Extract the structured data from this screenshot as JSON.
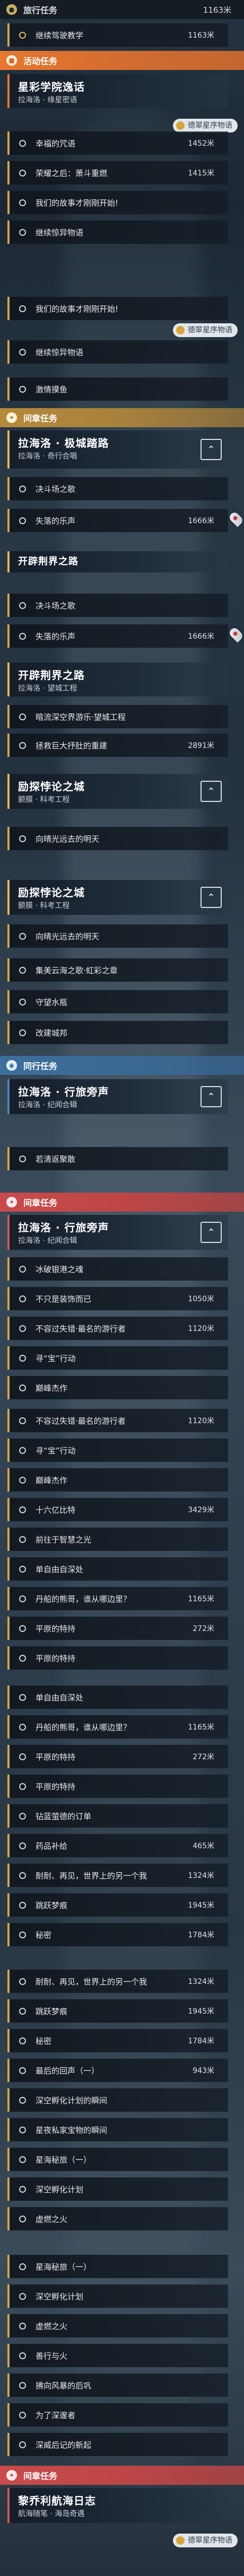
{
  "sections": {
    "journey": {
      "label": "旅行任务",
      "count": "1163米",
      "icon": "location-pin-icon"
    },
    "event": {
      "label": "活动任务",
      "icon": "calendar-icon"
    },
    "interlude1": {
      "label": "间章任务",
      "icon": "sparkle-icon"
    },
    "companion1": {
      "label": "同行任务",
      "icon": "people-icon"
    },
    "interlude2": {
      "label": "间章任务",
      "icon": "sparkle-icon"
    },
    "companion2": {
      "label": "同行任务",
      "icon": "people-icon"
    },
    "interlude3": {
      "label": "间章任务",
      "icon": "sparkle-icon"
    }
  },
  "rows": {
    "r0": {
      "label": "继续驾驶教学",
      "dist": "1163米"
    },
    "r1": {
      "label": "幸福的咒语",
      "dist": "1452米"
    },
    "r2": {
      "label": "荣耀之后：萧斗重燃",
      "dist": "1415米"
    },
    "r3": {
      "label": "我们的故事才刚刚开始!",
      "dist": ""
    },
    "r4": {
      "label": "继续惊异物语",
      "dist": ""
    },
    "r5": {
      "label": "我们的故事才刚刚开始!",
      "dist": ""
    },
    "r6": {
      "label": "继续惊异物语",
      "dist": ""
    },
    "r7": {
      "label": "激情摸鱼",
      "dist": ""
    },
    "r8": {
      "label": "决斗场之歌",
      "dist": ""
    },
    "r9": {
      "label": "失落的乐声",
      "dist": "1666米"
    },
    "r10": {
      "label": "决斗场之歌",
      "dist": ""
    },
    "r11": {
      "label": "失落的乐声",
      "dist": "1666米"
    },
    "r12": {
      "label": "暗流深空界游乐·望城工程",
      "dist": ""
    },
    "r13": {
      "label": "拯救巨大抒肚的重建",
      "dist": "2891米"
    },
    "r14": {
      "label": "向晴光远去的明天",
      "dist": ""
    },
    "r15": {
      "label": "向晴光远去的明天",
      "dist": ""
    },
    "r16": {
      "label": "集美云海之歌·虹彩之章",
      "dist": ""
    },
    "r17": {
      "label": "守望水瓶",
      "dist": ""
    },
    "r18": {
      "label": "改建城邦",
      "dist": ""
    },
    "r19": {
      "label": "若清返聚散",
      "dist": ""
    },
    "r20": {
      "label": "冰破银港之魂",
      "dist": ""
    },
    "r21": {
      "label": "不只是装饰而已",
      "dist": "1050米"
    },
    "r22": {
      "label": "不容过失错·最名的游行者",
      "dist": "1120米"
    },
    "r23": {
      "label": "寻“宝”行动",
      "dist": ""
    },
    "r24": {
      "label": "巅峰杰作",
      "dist": ""
    },
    "r25": {
      "label": "不容过失错·最名的游行者",
      "dist": "1120米"
    },
    "r26": {
      "label": "寻“宝”行动",
      "dist": ""
    },
    "r27": {
      "label": "巅峰杰作",
      "dist": ""
    },
    "r28": {
      "label": "十六亿比特",
      "dist": "3429米"
    },
    "r29": {
      "label": "前往于智慧之光",
      "dist": ""
    },
    "r30": {
      "label": "单自由自深处",
      "dist": ""
    },
    "r31": {
      "label": "丹船的熊哥，谁从哪边里？",
      "dist": "1165米"
    },
    "r32": {
      "label": "平原的特持",
      "dist": "272米"
    },
    "r33": {
      "label": "平原的特持",
      "dist": ""
    },
    "r34": {
      "label": "单自由自深处",
      "dist": ""
    },
    "r35": {
      "label": "丹船的熊哥，谁从哪边里？",
      "dist": "1165米"
    },
    "r36": {
      "label": "平原的特持",
      "dist": "272米"
    },
    "r37": {
      "label": "平原的特持",
      "dist": ""
    },
    "r38": {
      "label": "钻蓝萤德的订单",
      "dist": ""
    },
    "r39": {
      "label": "药品补给",
      "dist": "465米"
    },
    "r40": {
      "label": "耐耐、再见，世界上的另一个我",
      "dist": "1324米"
    },
    "r41": {
      "label": "跳跃梦痕",
      "dist": "1945米"
    },
    "r42": {
      "label": "秘密",
      "dist": "1784米"
    },
    "r43": {
      "label": "耐耐、再见，世界上的另一个我",
      "dist": "1324米"
    },
    "r44": {
      "label": "跳跃梦痕",
      "dist": "1945米"
    },
    "r45": {
      "label": "秘密",
      "dist": "1784米"
    },
    "r46": {
      "label": "最后的回声（一）",
      "dist": "943米"
    },
    "r47": {
      "label": "深空孵化计划的瞬间",
      "dist": ""
    },
    "r48": {
      "label": "星夜私家宝物的瞬间",
      "dist": ""
    },
    "r49": {
      "label": "星海秘旅（一）",
      "dist": ""
    },
    "r50": {
      "label": "深空孵化计划",
      "dist": ""
    },
    "r51": {
      "label": "虚燃之火",
      "dist": ""
    },
    "r52": {
      "label": "星海秘旅（一）",
      "dist": ""
    },
    "r53": {
      "label": "深空孵化计划",
      "dist": ""
    },
    "r54": {
      "label": "虚燃之火",
      "dist": ""
    },
    "r55": {
      "label": "善行与火",
      "dist": ""
    },
    "r56": {
      "label": "拂向风暴的后巩",
      "dist": ""
    },
    "r57": {
      "label": "为了深邃者",
      "dist": ""
    },
    "r58": {
      "label": "深威后记的新起",
      "dist": ""
    }
  },
  "cards": {
    "c1": {
      "title": "星彩学院逸话",
      "sub": "拉海洛 · 缘星密语"
    },
    "c2": {
      "title": "拉海洛 · 极城踏路",
      "sub": "拉海洛 · 奇行合唱"
    },
    "c3": {
      "title": "开辟荆界之路",
      "sub": ""
    },
    "c4": {
      "title": "开辟荆界之路",
      "sub": "拉海洛 · 望城工程"
    },
    "c5": {
      "title": "励探悖论之城",
      "sub": "颤膜 · 科考工程"
    },
    "c6": {
      "title": "励探悖论之城",
      "sub": "颤膜 · 科考工程"
    },
    "c7": {
      "title": "拉海洛 · 行旅旁声",
      "sub": "拉海洛 · 纪闻合辑"
    },
    "c8": {
      "title": "拉海洛 · 行旅旁声",
      "sub": "拉海洛 · 纪闻合辑"
    },
    "c9": {
      "title": "黎乔利航海日志",
      "sub": "航海随笔 · 海岛奇遇"
    }
  },
  "chips": {
    "k1": "德翠星序物语",
    "k2": "德翠星序物语",
    "k3": "德翠星序物语"
  },
  "colors": {
    "accent_gold": "#e2b554",
    "event_orange": "#e8772f",
    "companion_blue": "#4d84ba",
    "interlude_red": "#cf5656"
  }
}
